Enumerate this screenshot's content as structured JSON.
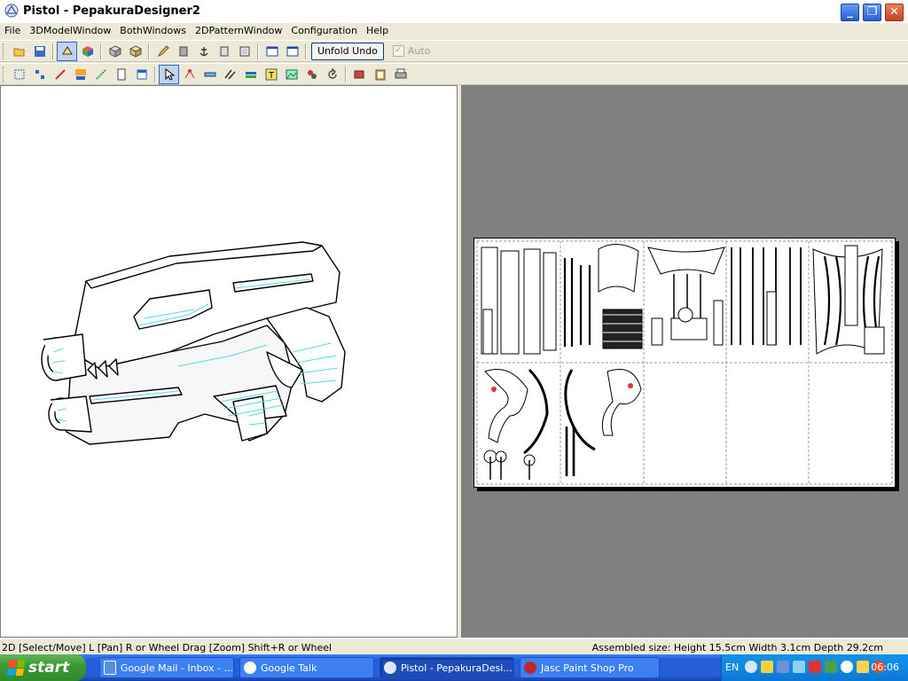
{
  "window": {
    "title": "Pistol - PepakuraDesigner2"
  },
  "menu": [
    "File",
    "3DModelWindow",
    "BothWindows",
    "2DPatternWindow",
    "Configuration",
    "Help"
  ],
  "toolbar": {
    "unfold_undo": "Unfold Undo",
    "auto_label": "Auto",
    "auto_checked": true
  },
  "status": {
    "left": "2D [Select/Move] L [Pan] R or Wheel Drag [Zoom] Shift+R or Wheel",
    "right": "Assembled size: Height 15.5cm Width 3.1cm Depth 29.2cm"
  },
  "taskbar": {
    "start_label": "start",
    "tasks": [
      {
        "label": "Google Mail - Inbox - ...",
        "icon": "browser-icon"
      },
      {
        "label": "Google Talk",
        "icon": "chat-icon"
      },
      {
        "label": "Pistol - PepakuraDesi...",
        "icon": "pepakura-icon"
      },
      {
        "label": "Jasc Paint Shop Pro",
        "icon": "paintshop-icon"
      }
    ],
    "lang": "EN",
    "clock": "06:06"
  },
  "colors": {
    "accent": "#316ac5",
    "model_highlight": "#4fd7e6",
    "pattern_bg": "#808080"
  }
}
